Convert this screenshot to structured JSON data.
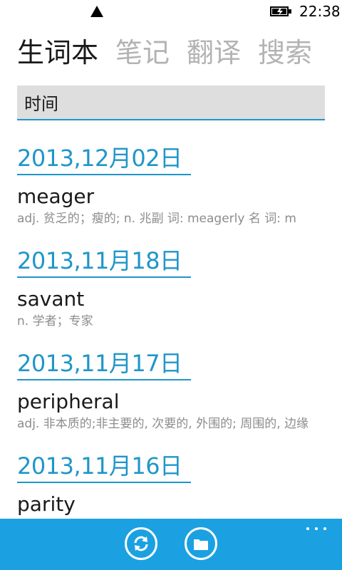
{
  "status_bar": {
    "time": "22:38",
    "signal_icon": "signal-triangle-icon",
    "battery_icon": "battery-charging-icon"
  },
  "pivot": {
    "tabs": [
      {
        "label": "生词本",
        "active": true
      },
      {
        "label": "笔记",
        "active": false
      },
      {
        "label": "翻译",
        "active": false
      },
      {
        "label": "搜索",
        "active": false
      }
    ]
  },
  "search": {
    "value": "时间"
  },
  "entries": [
    {
      "date": "2013,12月02日",
      "word": "meager",
      "definition": "adj. 贫乏的；瘦的; n. 兆副 词:  meagerly 名 词:  m"
    },
    {
      "date": "2013,11月18日",
      "word": "savant",
      "definition": "n. 学者；专家"
    },
    {
      "date": "2013,11月17日",
      "word": "peripheral",
      "definition": "adj. 非本质的;非主要的, 次要的, 外围的; 周围的, 边缘"
    },
    {
      "date": "2013,11月16日",
      "word": "parity",
      "definition": ""
    }
  ],
  "app_bar": {
    "buttons": [
      {
        "icon": "sync-icon"
      },
      {
        "icon": "folder-icon"
      }
    ],
    "more_icon": "more-dots-icon"
  },
  "colors": {
    "accent": "#1ba1e2",
    "header_blue": "#1f96c9",
    "search_bg": "#dedede"
  }
}
